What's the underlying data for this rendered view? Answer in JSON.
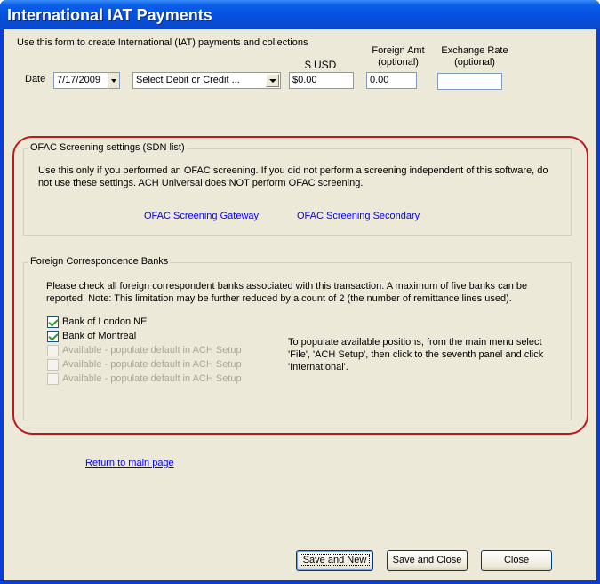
{
  "window": {
    "title": "International IAT Payments"
  },
  "form": {
    "intro": "Use this form to create International (IAT) payments and collections",
    "date_label": "Date",
    "date_value": "7/17/2009",
    "debit_credit_value": "Select Debit or Credit ...",
    "usd_label": "$ USD",
    "usd_value": "$0.00",
    "foreign_label_1": "Foreign Amt",
    "foreign_label_2": "(optional)",
    "foreign_value": "0.00",
    "exchange_label_1": "Exchange Rate",
    "exchange_label_2": "(optional)",
    "exchange_value": ""
  },
  "ofac": {
    "legend": "OFAC Screening settings (SDN list)",
    "text": "Use this only if you performed an OFAC screening.  If you did not perform a screening independent of this software, do not use these settings.  ACH Universal does NOT perform OFAC screening.",
    "gateway_link": "OFAC Screening Gateway",
    "secondary_link": "OFAC Screening Secondary"
  },
  "banks": {
    "legend": "Foreign Correspondence Banks",
    "text": "Please check all foreign correspondent banks associated with this transaction.  A maximum of five banks can be reported.  Note: This limitation may be further reduced by a count of 2 (the number of remittance lines used).",
    "items": [
      {
        "label": "Bank of London NE",
        "checked": true,
        "enabled": true
      },
      {
        "label": "Bank of Montreal",
        "checked": true,
        "enabled": true
      },
      {
        "label": "Available  - populate default in ACH Setup",
        "checked": false,
        "enabled": false
      },
      {
        "label": "Available  - populate default in ACH Setup",
        "checked": false,
        "enabled": false
      },
      {
        "label": "Available  - populate default in ACH Setup",
        "checked": false,
        "enabled": false
      }
    ],
    "note": "To populate available positions, from the main menu select 'File', 'ACH Setup', then click to the seventh panel and click 'International'."
  },
  "return_link": "Return to main page",
  "buttons": {
    "save_new": "Save and New",
    "save_close": "Save and Close",
    "close": "Close"
  },
  "colors": {
    "titlebar": "#0550e0",
    "panel": "#ece9d8",
    "highlight_oval": "#c01818",
    "link": "#0000ff"
  }
}
